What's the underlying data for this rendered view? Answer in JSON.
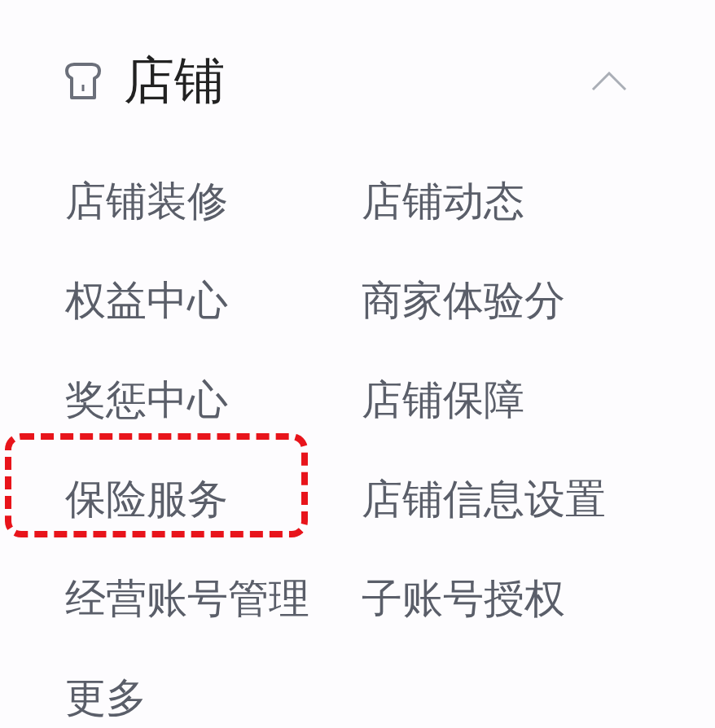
{
  "section": {
    "title": "店铺",
    "expanded": true
  },
  "items": [
    {
      "label": "店铺装修",
      "highlighted": false
    },
    {
      "label": "店铺动态",
      "highlighted": false
    },
    {
      "label": "权益中心",
      "highlighted": false
    },
    {
      "label": "商家体验分",
      "highlighted": false
    },
    {
      "label": "奖惩中心",
      "highlighted": false
    },
    {
      "label": "店铺保障",
      "highlighted": false
    },
    {
      "label": "保险服务",
      "highlighted": true
    },
    {
      "label": "店铺信息设置",
      "highlighted": false
    },
    {
      "label": "经营账号管理",
      "highlighted": false
    },
    {
      "label": "子账号授权",
      "highlighted": false
    },
    {
      "label": "更多",
      "highlighted": false
    }
  ]
}
